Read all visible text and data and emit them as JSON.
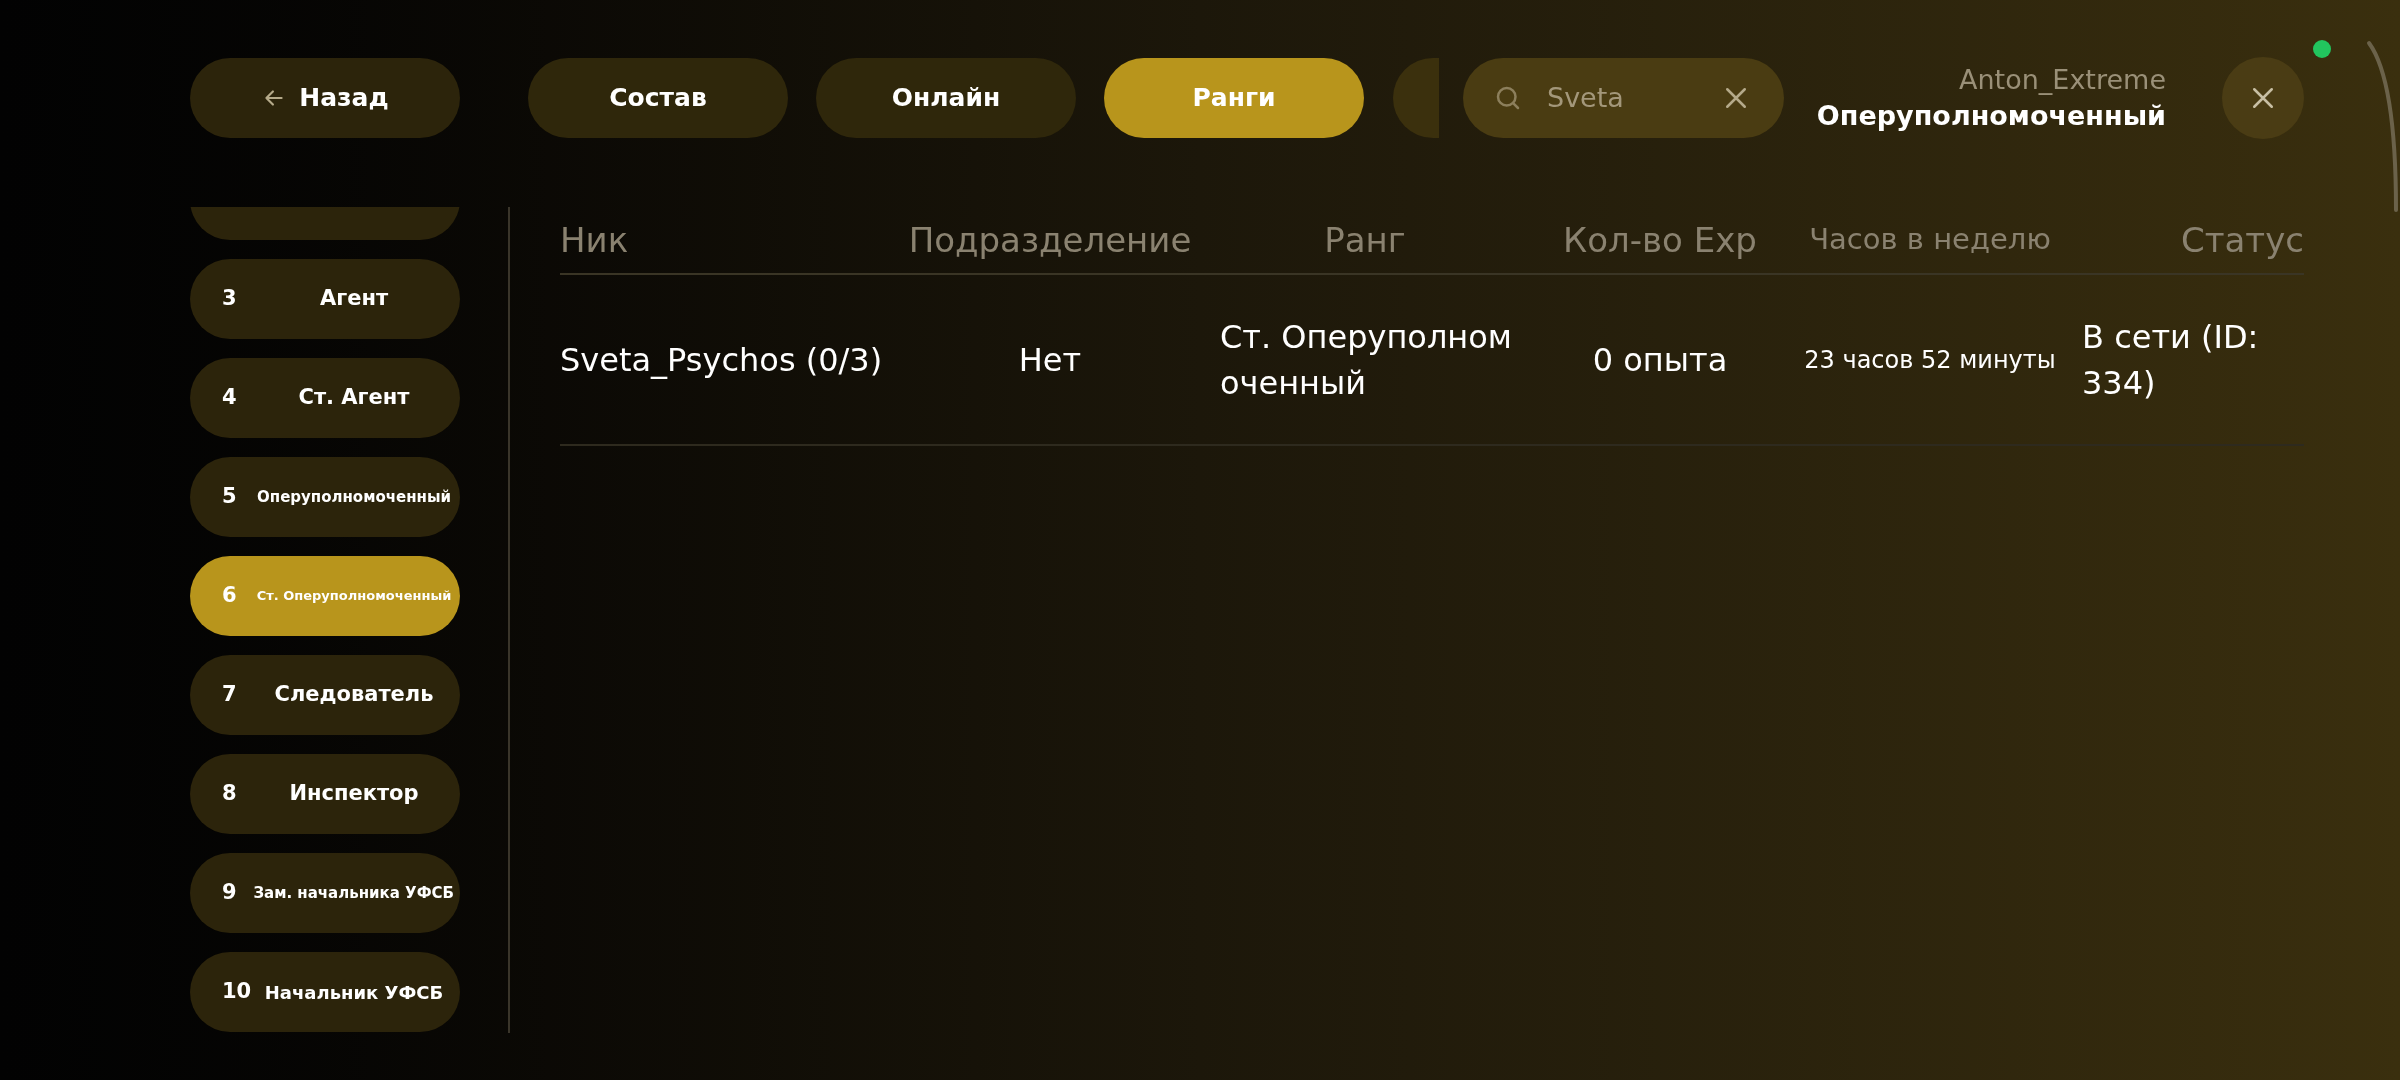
{
  "back_button": {
    "label": "Назад"
  },
  "tabs": [
    {
      "label": "Состав",
      "selected": false
    },
    {
      "label": "Онлайн",
      "selected": false
    },
    {
      "label": "Ранги",
      "selected": true
    }
  ],
  "search": {
    "value": "Sveta"
  },
  "user": {
    "name": "Anton_Extreme",
    "rank": "Оперуполномоченный",
    "online": true
  },
  "sidebar": {
    "items": [
      {
        "number": "3",
        "label": "Агент",
        "selected": false
      },
      {
        "number": "4",
        "label": "Ст. Агент",
        "selected": false
      },
      {
        "number": "5",
        "label": "Оперуполномоченный",
        "selected": false
      },
      {
        "number": "6",
        "label": "Ст. Оперуполномоченный",
        "selected": true
      },
      {
        "number": "7",
        "label": "Следователь",
        "selected": false
      },
      {
        "number": "8",
        "label": "Инспектор",
        "selected": false
      },
      {
        "number": "9",
        "label": "Зам. начальника УФСБ",
        "selected": false
      },
      {
        "number": "10",
        "label": "Начальник УФСБ",
        "selected": false
      }
    ]
  },
  "table": {
    "columns": [
      "Ник",
      "Подразделение",
      "Ранг",
      "Кол-во Exp",
      "Часов в неделю",
      "Статус"
    ],
    "rows": [
      {
        "nick": "Sveta_Psychos (0/3)",
        "division": "Нет",
        "rank": "Ст. Оперуполномоченный",
        "exp": "0 опыта",
        "hours": "23 часов 52 минуты",
        "status": "В сети (ID: 334)"
      }
    ]
  }
}
